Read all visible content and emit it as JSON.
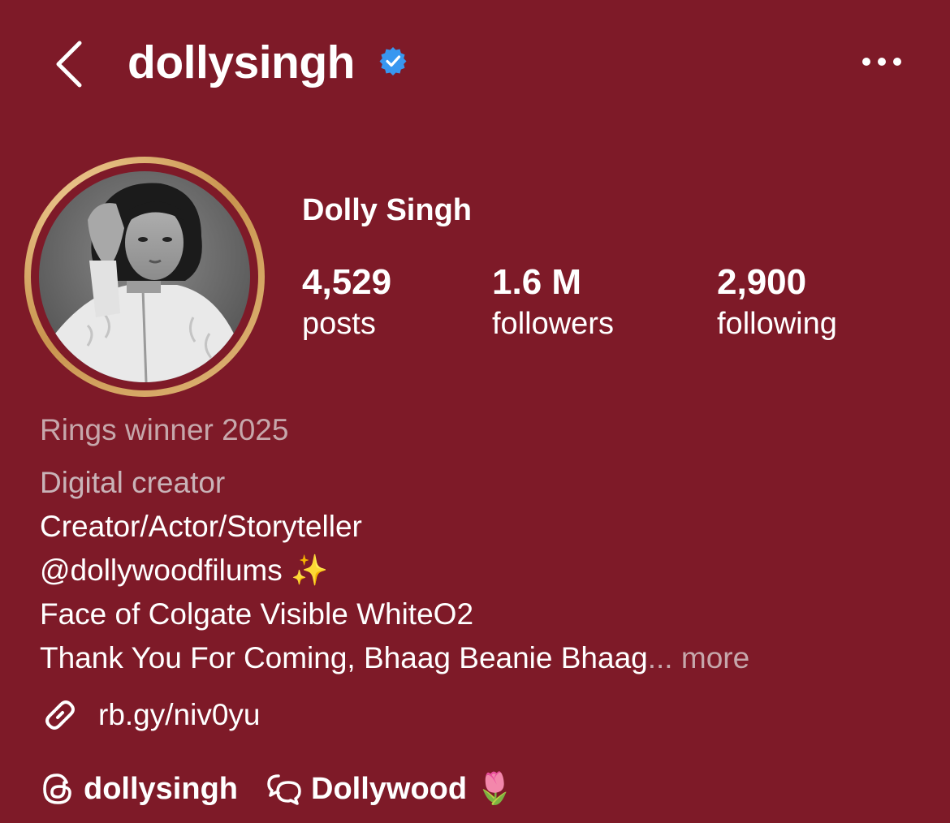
{
  "header": {
    "username": "dollysingh"
  },
  "profile": {
    "display_name": "Dolly Singh",
    "stats": [
      {
        "value": "4,529",
        "label": "posts"
      },
      {
        "value": "1.6 M",
        "label": "followers"
      },
      {
        "value": "2,900",
        "label": "following"
      }
    ]
  },
  "bio": {
    "award": "Rings winner 2025",
    "category": "Digital creator",
    "line1": "Creator/Actor/Storyteller",
    "line2": "@dollywoodfilums ✨",
    "line3": "Face of Colgate Visible WhiteO2",
    "line4": "Thank You For Coming, Bhaag Beanie Bhaag",
    "ellipsis": "...",
    "more": "more"
  },
  "link": {
    "text": "rb.gy/niv0yu"
  },
  "social": {
    "threads_handle": "dollysingh",
    "channel_name": "Dollywood 🌷"
  },
  "colors": {
    "background": "#7e1a28",
    "verified": "#3897f0",
    "ring_gold": "#e0b26e"
  }
}
